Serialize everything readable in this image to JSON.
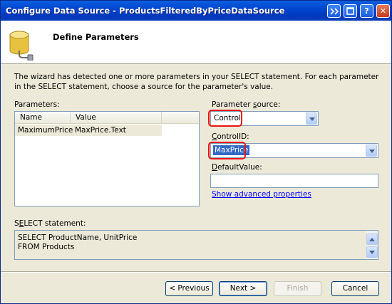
{
  "window": {
    "title": "Configure Data Source - ProductsFilteredByPriceDataSource",
    "controls": {
      "help": "?",
      "close": "✕"
    }
  },
  "header": {
    "title": "Define Parameters"
  },
  "description": "The wizard has detected one or more parameters in your SELECT statement. For each parameter in the SELECT statement, choose a source for the parameter's value.",
  "parameters": {
    "label": "Parameters:",
    "columns": [
      "Name",
      "Value"
    ],
    "rows": [
      {
        "name": "MaximumPrice",
        "value": "MaxPrice.Text"
      }
    ]
  },
  "parameter_source": {
    "label": "Parameter source:",
    "value": "Control"
  },
  "control_id": {
    "label": "ControlID:",
    "value": "MaxPrice"
  },
  "default_value": {
    "label": "DefaultValue:",
    "value": ""
  },
  "advanced_link": "Show advanced properties",
  "select_statement": {
    "label": "SELECT statement:",
    "lines": [
      "SELECT ProductName, UnitPrice",
      "FROM Products"
    ]
  },
  "buttons": {
    "previous": "< Previous",
    "next": "Next >",
    "finish": "Finish",
    "cancel": "Cancel"
  },
  "colors": {
    "titlebar": "#0046cf",
    "highlight_ring": "#e11111",
    "selection": "#316ac5",
    "link": "#0000ff"
  }
}
